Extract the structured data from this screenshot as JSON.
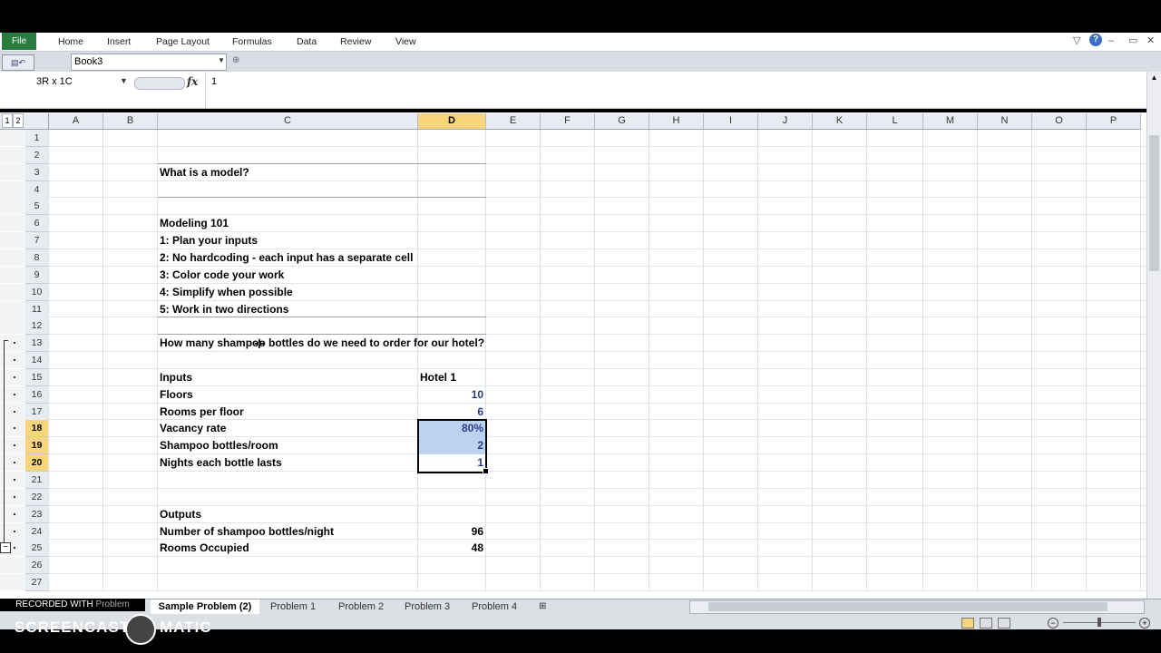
{
  "ribbon": {
    "file_label": "File",
    "tabs": [
      "Home",
      "Insert",
      "Page Layout",
      "Formulas",
      "Data",
      "Review",
      "View"
    ],
    "window_controls": [
      "▽",
      "?",
      "▭",
      "✕"
    ]
  },
  "workbook": {
    "name": "Book3"
  },
  "formula_bar": {
    "name_box": "3R x 1C",
    "fx": "fx",
    "value": "1"
  },
  "columns": [
    "A",
    "B",
    "C",
    "D",
    "E",
    "F",
    "G",
    "H",
    "I",
    "J",
    "K",
    "L",
    "M",
    "N",
    "O",
    "P"
  ],
  "selected_column": "D",
  "rows": [
    "1",
    "2",
    "3",
    "4",
    "5",
    "6",
    "7",
    "8",
    "9",
    "10",
    "11",
    "12",
    "13",
    "14",
    "15",
    "16",
    "17",
    "18",
    "19",
    "20",
    "21",
    "22",
    "23",
    "24",
    "25",
    "26",
    "27"
  ],
  "outline_levels": [
    "1",
    "2"
  ],
  "cells": {
    "r3": "What is a model?",
    "r6": "Modeling 101",
    "r7": "1: Plan your inputs",
    "r8": "2: No hardcoding - each input has a separate cell",
    "r9": "3: Color code your work",
    "r10": "4: Simplify when possible",
    "r11": "5: Work in two directions",
    "r13": "How many shampoo bottles do we need to order for our hotel?",
    "r15": "Inputs",
    "r15d": "Hotel 1",
    "r16": "Floors",
    "r16d": "10",
    "r17": "Rooms per floor",
    "r17d": "6",
    "r18": "Vacancy rate",
    "r18d": "80%",
    "r19": "Shampoo bottles/room",
    "r19d": "2",
    "r20": "Nights each bottle lasts",
    "r20d": "1",
    "r23": "Outputs",
    "r24": "Number of shampoo bottles/night",
    "r24d": "96",
    "r25": "Rooms Occupied",
    "r25d": "48"
  },
  "sheet_tabs": {
    "first_partial": "Problem",
    "active": "Sample Problem (2)",
    "others": [
      "Problem 1",
      "Problem 2",
      "Problem 3",
      "Problem 4"
    ]
  },
  "watermark": {
    "recorded": "RECORDED WITH",
    "brand_left": "SCREENCAST",
    "brand_right": "MATIC"
  },
  "colors": {
    "file_tab": "#2b7d3f",
    "selection_header": "#f8d57a",
    "selection_fill": "#bcd3f0",
    "input_text": "#2a3b8c"
  }
}
